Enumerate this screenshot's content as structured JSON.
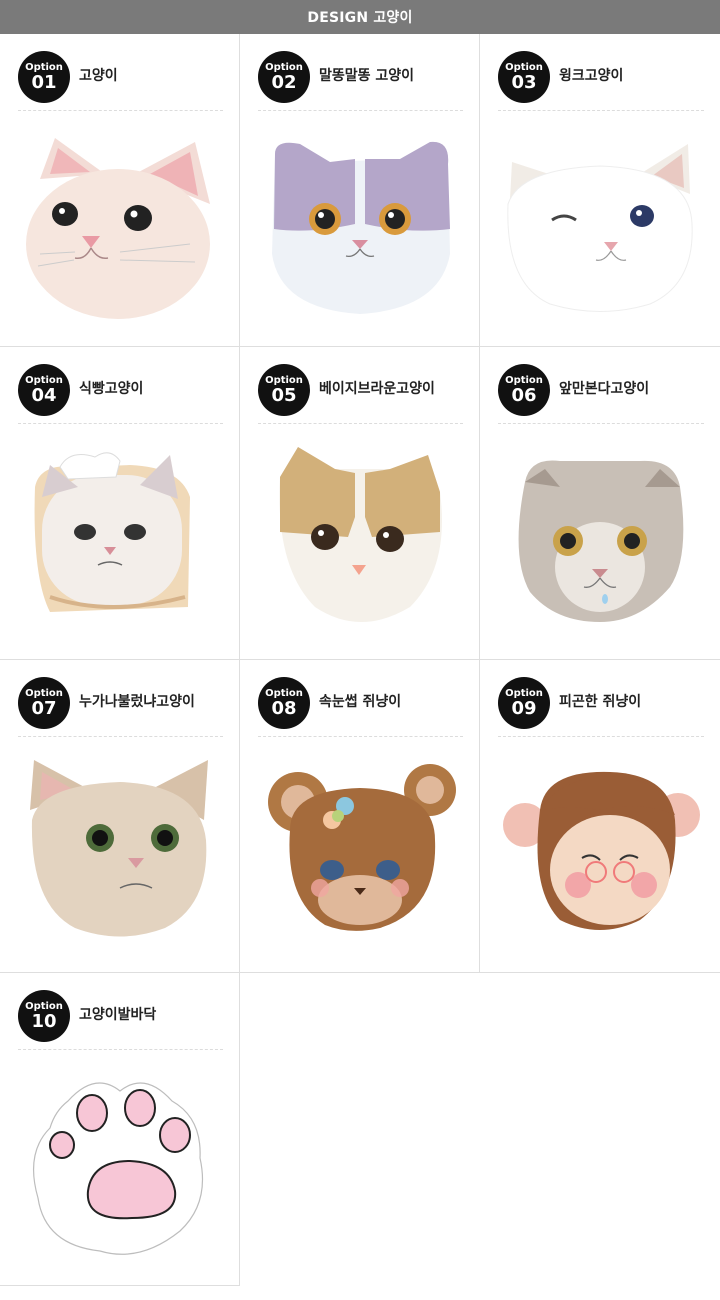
{
  "header": {
    "title": "DESIGN 고양이"
  },
  "option_word": "Option",
  "options": [
    {
      "num": "01",
      "name": "고양이",
      "icon": "white-cat-face"
    },
    {
      "num": "02",
      "name": "말똥말똥 고양이",
      "icon": "purple-gray-cat-face"
    },
    {
      "num": "03",
      "name": "윙크고양이",
      "icon": "winking-white-cat-face"
    },
    {
      "num": "04",
      "name": "식빵고양이",
      "icon": "bread-cat-face"
    },
    {
      "num": "05",
      "name": "베이지브라운고양이",
      "icon": "beige-brown-cat-face"
    },
    {
      "num": "06",
      "name": "앞만본다고양이",
      "icon": "gray-scottish-cat-face"
    },
    {
      "num": "07",
      "name": "누가나불렀냐고양이",
      "icon": "tabby-cat-face"
    },
    {
      "num": "08",
      "name": "속눈썹 쥐냥이",
      "icon": "brown-bear-mouse-face"
    },
    {
      "num": "09",
      "name": "피곤한 쥐냥이",
      "icon": "tired-mouse-face"
    },
    {
      "num": "10",
      "name": "고양이발바닥",
      "icon": "cat-paw"
    }
  ],
  "colors": {
    "header_bg": "#7a7a7a",
    "badge_bg": "#111111",
    "paw_pad": "#f7c6d6"
  }
}
